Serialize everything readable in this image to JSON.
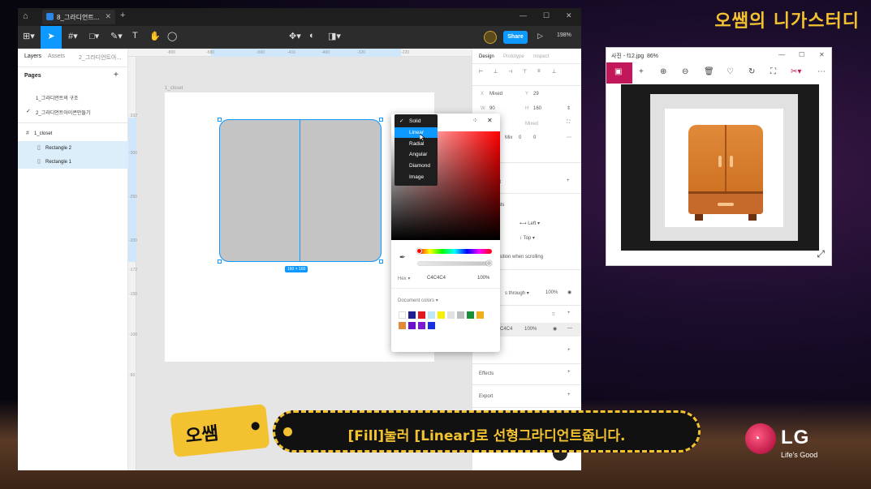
{
  "channel_title": "오쌤의 니가스터디",
  "figma": {
    "tab_title": "8_그라디언트...",
    "toolbar": {
      "share": "Share",
      "zoom": "198%"
    },
    "left_panel": {
      "tabs": [
        "Layers",
        "Assets",
        "2_그라디언트아..."
      ],
      "pages_header": "Pages",
      "pages": [
        "1_그라디언트의 구조",
        "2_그라디언트아이콘만들기"
      ],
      "layers": [
        {
          "name": "1_closet",
          "icon": "#"
        },
        {
          "name": "Rectangle 2",
          "icon": "▯"
        },
        {
          "name": "Rectangle 1",
          "icon": "▯"
        }
      ]
    },
    "canvas": {
      "frame_label": "1_closet",
      "dimension": "160 × 160",
      "ruler_top": [
        "-800",
        "-580",
        "-500",
        "-416",
        "-400",
        "-320",
        "-220"
      ],
      "ruler_left": [
        "-332",
        "-300",
        "-250",
        "-200",
        "-172",
        "-150",
        "-100",
        "-50"
      ]
    },
    "right_panel": {
      "tabs": [
        "Design",
        "Prototype",
        "Inspect"
      ],
      "x": "Mixed",
      "y": "29",
      "w": "90",
      "h": "160",
      "mixed": "Mixed",
      "corner": "Mix",
      "zero1": "0",
      "zero2": "0",
      "layout_partial": "ut",
      "constraints_partial": "ints",
      "left": "Left",
      "top": "Top",
      "fix_scroll": "osition when scrolling",
      "layer_blend": "s through",
      "layer_opacity": "100%",
      "fill_hex": "C4C4",
      "fill_opacity": "100%",
      "effects": "Effects",
      "export": "Export"
    },
    "picker": {
      "types": [
        "Solid",
        "Linear",
        "Radial",
        "Angular",
        "Diamond",
        "Image"
      ],
      "selected_type": "Solid",
      "hover_type": "Linear",
      "hex_label": "Hex",
      "hex": "C4C4C4",
      "opacity": "100%",
      "doc_colors_label": "Document colors",
      "doc_colors": [
        "#ffffff",
        "#1f1f8f",
        "#e0191f",
        "#bfe6f5",
        "#f5f00a",
        "#e2e2e2",
        "#bdbdbd",
        "#1a8f3a",
        "#f0b01c",
        "#e08a3a",
        "#6a12c9",
        "#7b1bd1",
        "#1a2fe0"
      ]
    }
  },
  "photos": {
    "title": "사진 - f12.jpg",
    "zoom": "86%"
  },
  "subtitle": {
    "speaker": "오쌤",
    "text": "[Fill]눌러 [Linear]로 선형그라디언트줍니다."
  },
  "lg": {
    "logo": "LG",
    "slogan": "Life's Good"
  }
}
